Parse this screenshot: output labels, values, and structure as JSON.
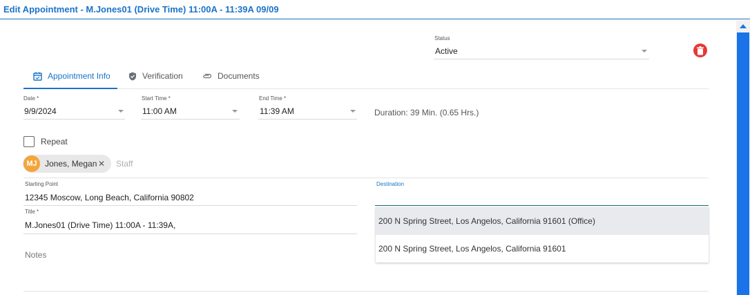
{
  "window": {
    "title": "Edit Appointment - M.Jones01 (Drive Time) 11:00A - 11:39A 09/09"
  },
  "status": {
    "label": "Status",
    "value": "Active"
  },
  "delete_button": {
    "icon": "trash-icon",
    "color": "#e53935"
  },
  "tabs": [
    {
      "label": "Appointment Info",
      "icon": "calendar-check-icon",
      "active": true
    },
    {
      "label": "Verification",
      "icon": "shield-check-icon",
      "active": false
    },
    {
      "label": "Documents",
      "icon": "paperclip-icon",
      "active": false
    }
  ],
  "date": {
    "label": "Date *",
    "value": "9/9/2024"
  },
  "start_time": {
    "label": "Start Time *",
    "value": "11:00 AM"
  },
  "end_time": {
    "label": "End Time *",
    "value": "11:39 AM"
  },
  "duration": {
    "text": "Duration: 39 Min. (0.65 Hrs.)"
  },
  "repeat": {
    "label": "Repeat",
    "checked": false
  },
  "staff": {
    "chips": [
      {
        "initials": "MJ",
        "name": "Jones, Megan",
        "avatar_color": "#f4a53a"
      }
    ],
    "placeholder": "Staff"
  },
  "starting_point": {
    "label": "Starting Point",
    "value": "12345 Moscow, Long Beach, California 90802"
  },
  "destination": {
    "label": "Destination",
    "value": "",
    "options": [
      "200 N Spring Street, Los Angelos, California 91601 (Office)",
      "200 N Spring Street, Los Angelos, California 91601"
    ]
  },
  "title_field": {
    "label": "Title *",
    "value": "M.Jones01  (Drive Time)  11:00A - 11:39A,"
  },
  "notes": {
    "label": "Notes"
  },
  "accent_color": "#1a73c8"
}
